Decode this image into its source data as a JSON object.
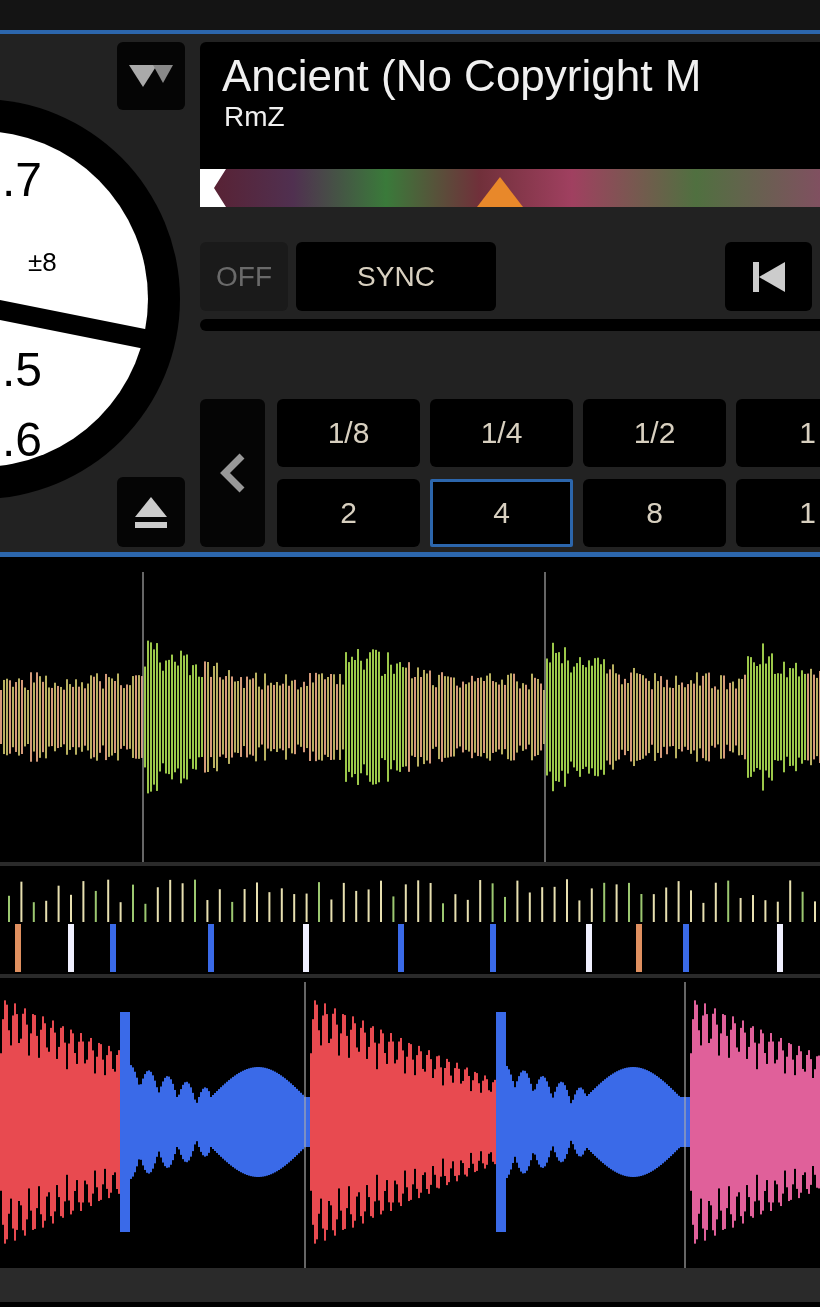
{
  "platter": {
    "readings": [
      ".7",
      "±8",
      ".5",
      ".6"
    ]
  },
  "track": {
    "title": "Ancient (No Copyright M",
    "artist": "RmZ"
  },
  "controls": {
    "off": "OFF",
    "sync": "SYNC"
  },
  "loop_rows": [
    [
      {
        "label": "1/8",
        "selected": false
      },
      {
        "label": "1/4",
        "selected": false
      },
      {
        "label": "1/2",
        "selected": false
      },
      {
        "label": "1",
        "selected": false
      }
    ],
    [
      {
        "label": "2",
        "selected": false
      },
      {
        "label": "4",
        "selected": true
      },
      {
        "label": "8",
        "selected": false
      },
      {
        "label": "1",
        "selected": false
      }
    ]
  ]
}
